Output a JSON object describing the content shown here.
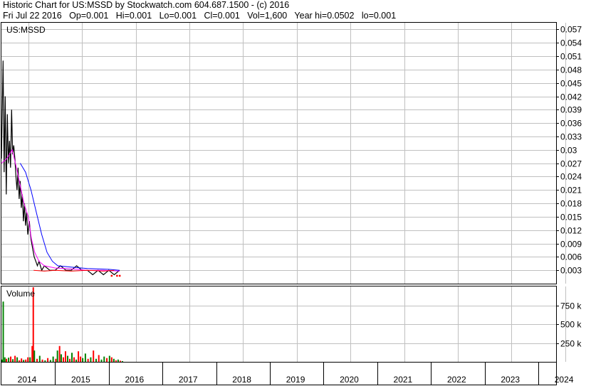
{
  "header": {
    "line1": "Historic Chart for US:MSSD by Stockwatch.com 604.687.1500 - (c) 2016",
    "line2": "Fri Jul 22 2016   Op=0.001   Hi=0.001   Lo=0.001   Cl=0.001   Vol=1,600   Year hi=0.0502   lo=0.001"
  },
  "chart_data": [
    {
      "type": "line",
      "title": "US:MSSD",
      "y_ticks": [
        "0.057",
        "0.054",
        "0.051",
        "0.048",
        "0.045",
        "0.042",
        "0.039",
        "0.036",
        "0.033",
        "0.03",
        "0.027",
        "0.024",
        "0.021",
        "0.018",
        "0.015",
        "0.012",
        "0.009",
        "0.006",
        "0.003"
      ],
      "ylim": [
        0,
        0.0585
      ],
      "xlim": [
        2014.0,
        2024.33
      ],
      "grid": true,
      "series": [
        {
          "color": "#000000",
          "points": [
            [
              2014.0,
              0.028
            ],
            [
              2014.03,
              0.05
            ],
            [
              2014.05,
              0.025
            ],
            [
              2014.07,
              0.042
            ],
            [
              2014.09,
              0.02
            ],
            [
              2014.11,
              0.038
            ],
            [
              2014.13,
              0.027
            ],
            [
              2014.15,
              0.032
            ],
            [
              2014.17,
              0.026
            ],
            [
              2014.19,
              0.039
            ],
            [
              2014.21,
              0.029
            ],
            [
              2014.23,
              0.031
            ],
            [
              2014.25,
              0.028
            ],
            [
              2014.27,
              0.024
            ],
            [
              2014.29,
              0.021
            ],
            [
              2014.31,
              0.026
            ],
            [
              2014.33,
              0.019
            ],
            [
              2014.35,
              0.023
            ],
            [
              2014.37,
              0.017
            ],
            [
              2014.39,
              0.02
            ],
            [
              2014.41,
              0.014
            ],
            [
              2014.43,
              0.018
            ],
            [
              2014.45,
              0.013
            ],
            [
              2014.47,
              0.016
            ],
            [
              2014.49,
              0.011
            ],
            [
              2014.52,
              0.014
            ],
            [
              2014.55,
              0.01
            ],
            [
              2014.58,
              0.008
            ],
            [
              2014.61,
              0.006
            ],
            [
              2014.64,
              0.005
            ],
            [
              2014.67,
              0.004
            ],
            [
              2014.7,
              0.005
            ],
            [
              2014.75,
              0.003
            ],
            [
              2014.8,
              0.004
            ],
            [
              2014.9,
              0.003
            ],
            [
              2015.0,
              0.003
            ],
            [
              2015.1,
              0.004
            ],
            [
              2015.2,
              0.003
            ],
            [
              2015.3,
              0.003
            ],
            [
              2015.4,
              0.004
            ],
            [
              2015.5,
              0.003
            ],
            [
              2015.6,
              0.003
            ],
            [
              2015.7,
              0.002
            ],
            [
              2015.8,
              0.003
            ],
            [
              2015.9,
              0.002
            ],
            [
              2016.0,
              0.003
            ],
            [
              2016.1,
              0.002
            ],
            [
              2016.2,
              0.003
            ]
          ]
        },
        {
          "color": "#ff00ff",
          "points": [
            [
              2014.0,
              0.027
            ],
            [
              2014.1,
              0.028
            ],
            [
              2014.2,
              0.03
            ],
            [
              2014.28,
              0.026
            ],
            [
              2014.35,
              0.022
            ],
            [
              2014.42,
              0.018
            ],
            [
              2014.5,
              0.015
            ],
            [
              2014.56,
              0.01
            ],
            [
              2014.62,
              0.007
            ],
            [
              2014.7,
              0.005
            ],
            [
              2014.8,
              0.004
            ],
            [
              2015.0,
              0.0035
            ],
            [
              2015.3,
              0.0033
            ],
            [
              2015.6,
              0.003
            ],
            [
              2015.9,
              0.003
            ],
            [
              2016.2,
              0.0028
            ]
          ]
        },
        {
          "color": "#0000ff",
          "points": [
            [
              2014.35,
              0.027
            ],
            [
              2014.45,
              0.025
            ],
            [
              2014.55,
              0.021
            ],
            [
              2014.65,
              0.016
            ],
            [
              2014.75,
              0.011
            ],
            [
              2014.85,
              0.007
            ],
            [
              2014.95,
              0.005
            ],
            [
              2015.05,
              0.004
            ],
            [
              2015.3,
              0.0037
            ],
            [
              2015.6,
              0.0034
            ],
            [
              2016.0,
              0.0032
            ],
            [
              2016.2,
              0.003
            ]
          ]
        },
        {
          "color": "#ff0000",
          "points": [
            [
              2014.6,
              0.003
            ],
            [
              2014.8,
              0.0028
            ],
            [
              2015.0,
              0.003
            ],
            [
              2015.3,
              0.0028
            ],
            [
              2015.6,
              0.003
            ],
            [
              2015.9,
              0.0028
            ],
            [
              2016.1,
              0.003
            ]
          ]
        }
      ],
      "red_markers": [
        [
          2016.05,
          0.0018
        ],
        [
          2016.15,
          0.0018
        ],
        [
          2016.2,
          0.0018
        ]
      ]
    },
    {
      "type": "bar",
      "title": "Volume",
      "y_ticks": [
        "750 k",
        "500 k",
        "250 k"
      ],
      "ylim": [
        0,
        1000000
      ],
      "xlim": [
        2014.0,
        2024.33
      ],
      "grid": true,
      "bars": [
        [
          2014.0,
          30000,
          "#008000"
        ],
        [
          2014.02,
          800000,
          "#008000"
        ],
        [
          2014.05,
          60000,
          "#008000"
        ],
        [
          2014.08,
          40000,
          "#ff0000"
        ],
        [
          2014.12,
          55000,
          "#008000"
        ],
        [
          2014.16,
          70000,
          "#ff0000"
        ],
        [
          2014.2,
          35000,
          "#008000"
        ],
        [
          2014.24,
          80000,
          "#ff0000"
        ],
        [
          2014.28,
          60000,
          "#008000"
        ],
        [
          2014.32,
          20000,
          "#ff0000"
        ],
        [
          2014.36,
          45000,
          "#ff0000"
        ],
        [
          2014.4,
          25000,
          "#008000"
        ],
        [
          2014.44,
          30000,
          "#ff0000"
        ],
        [
          2014.48,
          60000,
          "#ff0000"
        ],
        [
          2014.52,
          60000,
          "#008000"
        ],
        [
          2014.56,
          210000,
          "#ff0000"
        ],
        [
          2014.58,
          990000,
          "#ff0000"
        ],
        [
          2014.6,
          150000,
          "#008000"
        ],
        [
          2014.65,
          40000,
          "#ff0000"
        ],
        [
          2014.7,
          80000,
          "#008000"
        ],
        [
          2014.75,
          30000,
          "#ff0000"
        ],
        [
          2014.8,
          20000,
          "#008000"
        ],
        [
          2014.85,
          50000,
          "#ff0000"
        ],
        [
          2014.9,
          25000,
          "#008000"
        ],
        [
          2014.95,
          70000,
          "#008000"
        ],
        [
          2015.0,
          40000,
          "#ff0000"
        ],
        [
          2015.03,
          150000,
          "#008000"
        ],
        [
          2015.07,
          210000,
          "#ff0000"
        ],
        [
          2015.1,
          100000,
          "#008000"
        ],
        [
          2015.14,
          60000,
          "#ff0000"
        ],
        [
          2015.18,
          140000,
          "#ff0000"
        ],
        [
          2015.22,
          80000,
          "#008000"
        ],
        [
          2015.26,
          40000,
          "#ff0000"
        ],
        [
          2015.3,
          120000,
          "#008000"
        ],
        [
          2015.34,
          60000,
          "#ff0000"
        ],
        [
          2015.38,
          30000,
          "#008000"
        ],
        [
          2015.42,
          140000,
          "#ff0000"
        ],
        [
          2015.46,
          70000,
          "#ff0000"
        ],
        [
          2015.5,
          50000,
          "#008000"
        ],
        [
          2015.55,
          110000,
          "#008000"
        ],
        [
          2015.6,
          40000,
          "#ff0000"
        ],
        [
          2015.65,
          60000,
          "#008000"
        ],
        [
          2015.7,
          150000,
          "#ff0000"
        ],
        [
          2015.75,
          40000,
          "#008000"
        ],
        [
          2015.8,
          90000,
          "#ff0000"
        ],
        [
          2015.85,
          30000,
          "#008000"
        ],
        [
          2015.9,
          70000,
          "#008000"
        ],
        [
          2015.95,
          50000,
          "#ff0000"
        ],
        [
          2016.0,
          80000,
          "#008000"
        ],
        [
          2016.04,
          60000,
          "#ff0000"
        ],
        [
          2016.08,
          40000,
          "#008000"
        ],
        [
          2016.12,
          20000,
          "#ff0000"
        ],
        [
          2016.16,
          30000,
          "#008000"
        ],
        [
          2016.2,
          15000,
          "#ff0000"
        ],
        [
          2016.24,
          10000,
          "#008000"
        ]
      ]
    }
  ],
  "x_axis": {
    "labels": [
      {
        "text": "2014",
        "at": 2014.0
      },
      {
        "text": "2015",
        "at": 2015.0
      },
      {
        "text": "2016",
        "at": 2016.0
      },
      {
        "text": "2017",
        "at": 2017.0
      },
      {
        "text": "2018",
        "at": 2018.0
      },
      {
        "text": "2019",
        "at": 2019.0
      },
      {
        "text": "2020",
        "at": 2020.0
      },
      {
        "text": "2021",
        "at": 2021.0
      },
      {
        "text": "2022",
        "at": 2022.0
      },
      {
        "text": "2023",
        "at": 2023.0
      },
      {
        "text": "2024",
        "at": 2024.0
      }
    ]
  },
  "colors": {
    "grid": "#c0c0c0",
    "price_line": "#000000",
    "ma_short": "#ff00ff",
    "ma_long": "#0000ff",
    "up_volume": "#008000",
    "down_volume": "#ff0000"
  }
}
